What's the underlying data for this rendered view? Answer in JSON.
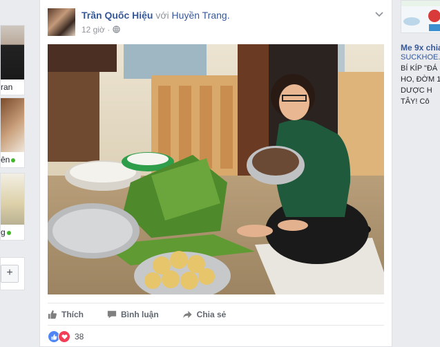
{
  "left_column": {
    "cards": [
      {
        "label": "ran",
        "online": false
      },
      {
        "label": "ên",
        "online": true
      },
      {
        "label": "g",
        "online": true
      }
    ],
    "plus_label": "+"
  },
  "post": {
    "author": "Trần Quốc Hiệu",
    "with_text": "với",
    "tagged": "Huyền Trang.",
    "time": "12 giờ",
    "actions": {
      "like": "Thích",
      "comment": "Bình luận",
      "share": "Chia sẻ"
    },
    "reaction_count": "38"
  },
  "right_column": {
    "ad_title": "Me 9x chia",
    "ad_url": "SUCKHOE.",
    "ad_lines": [
      "BÍ KÍP \"ĐÁ",
      "HO, ĐỜM 1",
      "DƯỢC  H",
      "TÂY!  Cô"
    ]
  },
  "colors": {
    "link": "#365899",
    "muted": "#90949c",
    "like_blue": "#4e86f6",
    "love_red": "#f33e58",
    "page_bg": "#e9ebee"
  }
}
